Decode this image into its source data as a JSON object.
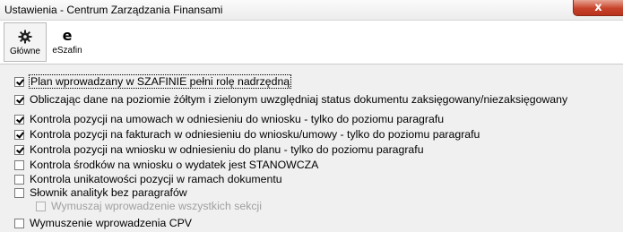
{
  "window": {
    "title": "Ustawienia - Centrum Zarządzania Finansami",
    "close_label": "x"
  },
  "toolbar": {
    "buttons": [
      {
        "label": "Główne",
        "icon": "gear-icon",
        "active": true
      },
      {
        "label": "eSzafin",
        "icon": "e-letter-icon",
        "active": false
      }
    ]
  },
  "options": [
    {
      "label": "Plan wprowadzany w SZAFINIE pełni rolę nadrzędną",
      "checked": true,
      "disabled": false
    },
    {
      "label": "Obliczając dane na poziomie żółtym i zielonym uwzględniaj status dokumentu zaksięgowany/niezaksięgowany",
      "checked": true,
      "disabled": false
    },
    {
      "label": "Kontrola pozycji na umowach w odniesieniu do wniosku - tylko do poziomu paragrafu",
      "checked": true,
      "disabled": false
    },
    {
      "label": "Kontrola pozycji na fakturach w odniesieniu do wniosku/umowy - tylko do poziomu paragrafu",
      "checked": true,
      "disabled": false
    },
    {
      "label": "Kontrola pozycji na wniosku w odniesieniu do planu - tylko do poziomu paragrafu",
      "checked": true,
      "disabled": false
    },
    {
      "label": "Kontrola środków na wniosku o wydatek jest STANOWCZA",
      "checked": false,
      "disabled": false
    },
    {
      "label": "Kontrola unikatowości pozycji w ramach dokumentu",
      "checked": false,
      "disabled": false
    },
    {
      "label": "Słownik analityk bez paragrafów",
      "checked": false,
      "disabled": false
    },
    {
      "label": "Wymuszaj wprowadzenie wszystkich sekcji",
      "checked": false,
      "disabled": true
    },
    {
      "label": "Wymuszenie wprowadzenia CPV",
      "checked": false,
      "disabled": false
    }
  ]
}
